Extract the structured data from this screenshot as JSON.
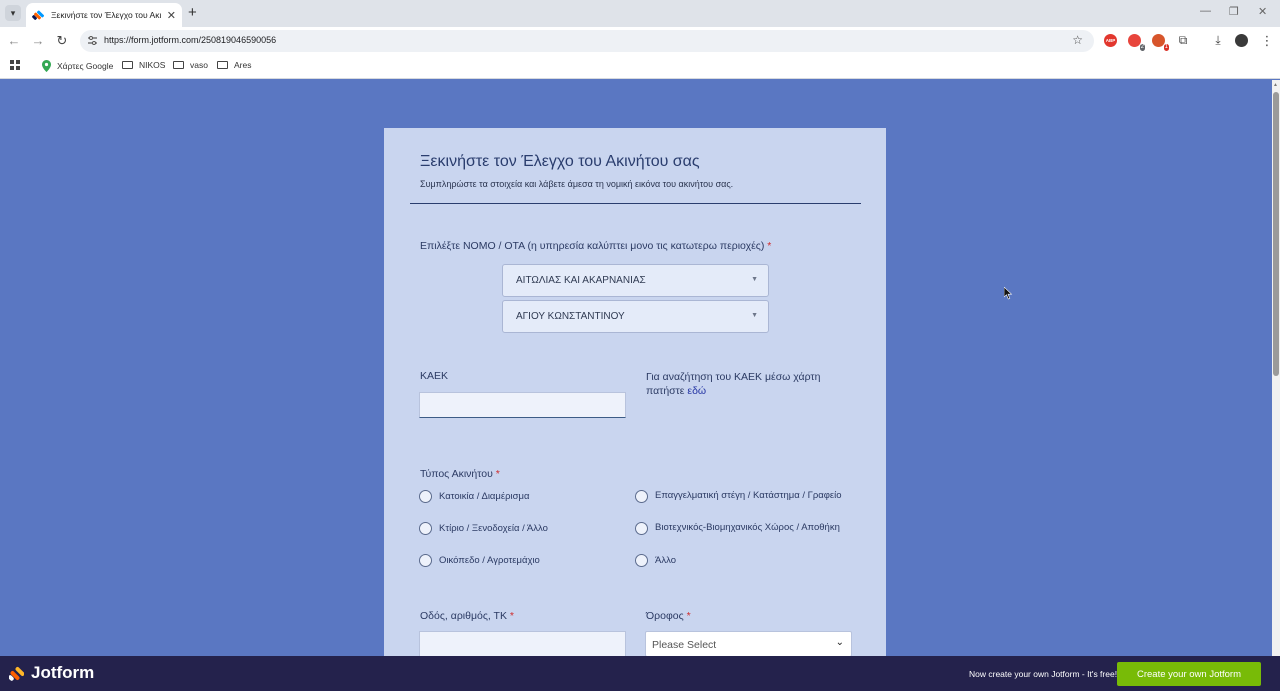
{
  "browser": {
    "tab_title": "Ξεκινήστε τον Έλεγχο του Ακινή",
    "url": "https://form.jotform.com/250819046590056",
    "extension_badges": [
      "2",
      "1"
    ],
    "adblock_label": "ABP",
    "bookmarks": [
      {
        "label": "Χάρτες Google",
        "icon": "maps-pin-icon"
      },
      {
        "label": "NIKOS",
        "icon": "folder-icon"
      },
      {
        "label": "vaso",
        "icon": "folder-icon"
      },
      {
        "label": "Ares",
        "icon": "folder-icon"
      }
    ]
  },
  "form": {
    "title": "Ξεκινήστε τον Έλεγχο του Ακινήτου σας",
    "subtitle": "Συμπληρώστε τα στοιχεία και λάβετε άμεσα τη νομική εικόνα του ακινήτου σας.",
    "region_label": "Επιλέξτε ΝΟΜΟ / ΟΤΑ (η υπηρεσία καλύπτει μονο τις κατωτερω περιοχές)",
    "required_mark": "*",
    "nomos_value": "ΑΙΤΩΛΙΑΣ ΚΑΙ ΑΚΑΡΝΑΝΙΑΣ",
    "ota_value": "ΑΓΙΟΥ ΚΩΝΣΤΑΝΤΙΝΟΥ",
    "kaek_label": "ΚΑΕΚ",
    "kaek_value": "",
    "kaek_help": "Για αναζήτηση του ΚΑΕΚ μέσω χάρτη πατήστε",
    "kaek_help_link": "εδώ",
    "property_type_label": "Τύπος Ακινήτου",
    "property_types": [
      "Κατοικία / Διαμέρισμα",
      "Επαγγελματική στέγη / Κατάστημα / Γραφείο",
      "Κτίριο / Ξενοδοχεία / Άλλο",
      "Βιοτεχνικός-Βιομηχανικός Χώρος / Αποθήκη",
      "Οικόπεδο / Αγροτεμάχιο",
      "Άλλο"
    ],
    "address_label": "Οδός, αριθμός, ΤΚ",
    "address_value": "",
    "floor_label": "Όροφος",
    "floor_value": "Please Select"
  },
  "jotform_bar": {
    "logo_text": "Jotform",
    "promo_text": "Now create your own Jotform - It's free!",
    "cta_label": "Create your own Jotform",
    "cta_color": "#78bb07"
  }
}
